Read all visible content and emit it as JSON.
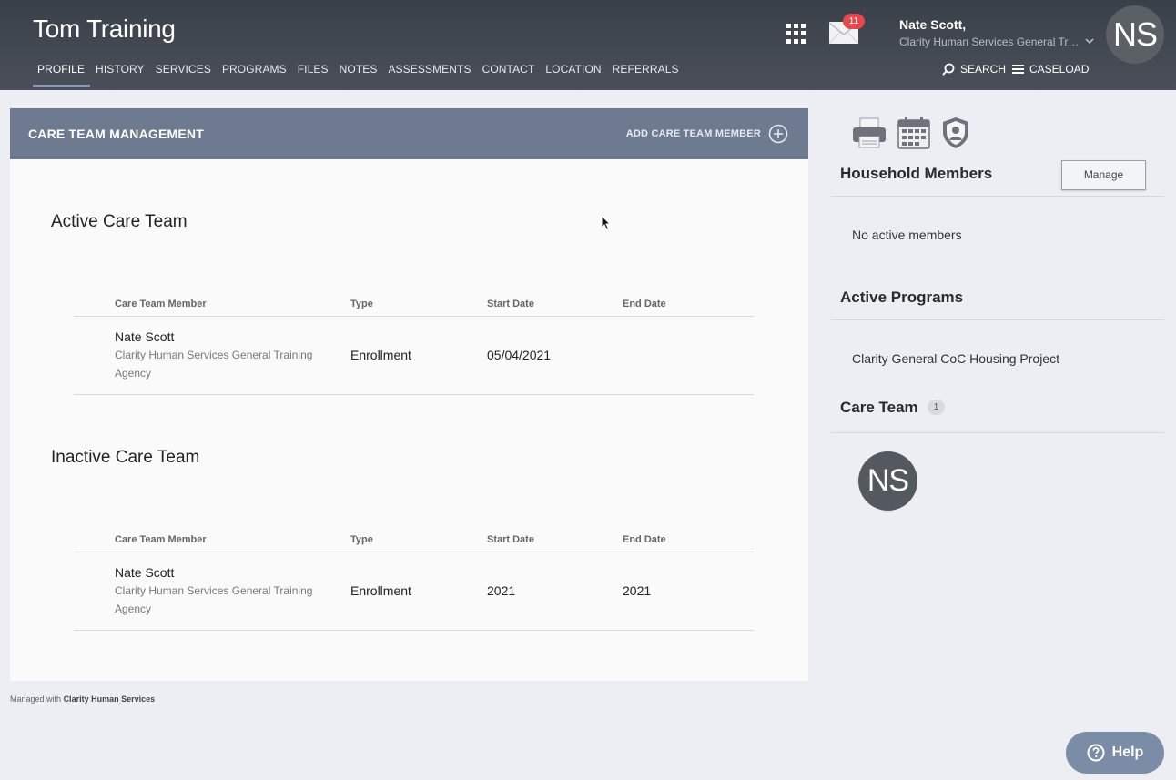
{
  "header": {
    "client_name": "Tom Training",
    "tabs": [
      {
        "label": "PROFILE",
        "active": true
      },
      {
        "label": "HISTORY"
      },
      {
        "label": "SERVICES"
      },
      {
        "label": "PROGRAMS"
      },
      {
        "label": "FILES"
      },
      {
        "label": "NOTES"
      },
      {
        "label": "ASSESSMENTS"
      },
      {
        "label": "CONTACT"
      },
      {
        "label": "LOCATION"
      },
      {
        "label": "REFERRALS"
      }
    ],
    "mail_count": "11",
    "user_name": "Nate Scott,",
    "user_agency": "Clarity Human Services General Training Agency",
    "user_initials": "NS",
    "search_label": "SEARCH",
    "caseload_label": "CASELOAD"
  },
  "card": {
    "title": "CARE TEAM MANAGEMENT",
    "add_label": "ADD CARE TEAM MEMBER",
    "active_title": "Active Care Team",
    "inactive_title": "Inactive Care Team",
    "columns": [
      "Care Team Member",
      "Type",
      "Start Date",
      "End Date"
    ],
    "active_rows": [
      {
        "name": "Nate Scott",
        "agency": "Clarity Human Services General Training Agency",
        "type": "Enrollment",
        "start": "05/04/2021",
        "end": ""
      }
    ],
    "inactive_rows": [
      {
        "name": "Nate Scott",
        "agency": "Clarity Human Services General Training Agency",
        "type": "Enrollment",
        "start": "2021",
        "end": "2021"
      }
    ]
  },
  "footer": {
    "prefix": "Managed with",
    "brand": "Clarity Human Services"
  },
  "side": {
    "household_title": "Household Members",
    "manage_label": "Manage",
    "household_empty": "No active members",
    "programs_title": "Active Programs",
    "program_name": "Clarity General CoC Housing Project",
    "care_team_title": "Care Team",
    "care_team_count": "1",
    "member_initials": "NS"
  },
  "help_label": "Help",
  "colors": {
    "header_bg": "#3a4049",
    "card_head": "#6d7a8f",
    "badge": "#e5484d",
    "help_bg": "#7b8ca6"
  }
}
